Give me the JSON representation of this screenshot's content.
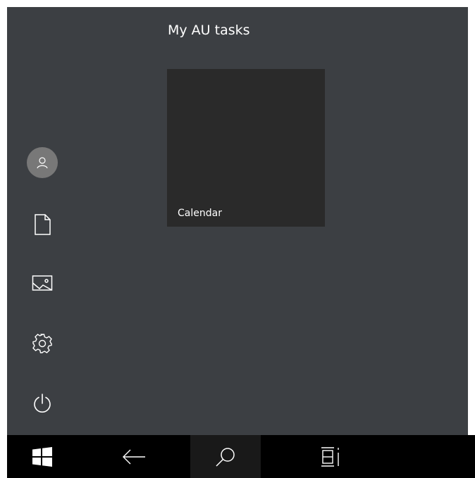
{
  "start_menu": {
    "group_title": "My AU tasks",
    "tiles": [
      {
        "label": "Calendar",
        "icon": "calendar-tile"
      }
    ],
    "rail": [
      {
        "name": "user-account",
        "icon": "user-icon"
      },
      {
        "name": "documents",
        "icon": "document-icon"
      },
      {
        "name": "pictures",
        "icon": "picture-icon"
      },
      {
        "name": "settings",
        "icon": "gear-icon"
      },
      {
        "name": "power",
        "icon": "power-icon"
      }
    ]
  },
  "taskbar": {
    "buttons": [
      {
        "name": "start",
        "icon": "windows-logo-icon"
      },
      {
        "name": "back",
        "icon": "back-arrow-icon"
      },
      {
        "name": "search",
        "icon": "search-icon",
        "active": true
      },
      {
        "name": "task-view",
        "icon": "task-view-icon"
      }
    ]
  },
  "colors": {
    "start_background": "#3c3f43",
    "tile_background": "#2a2a2a",
    "taskbar_background": "#000000",
    "active_button_background": "#191919",
    "avatar_background": "#787878",
    "foreground": "#ffffff"
  }
}
